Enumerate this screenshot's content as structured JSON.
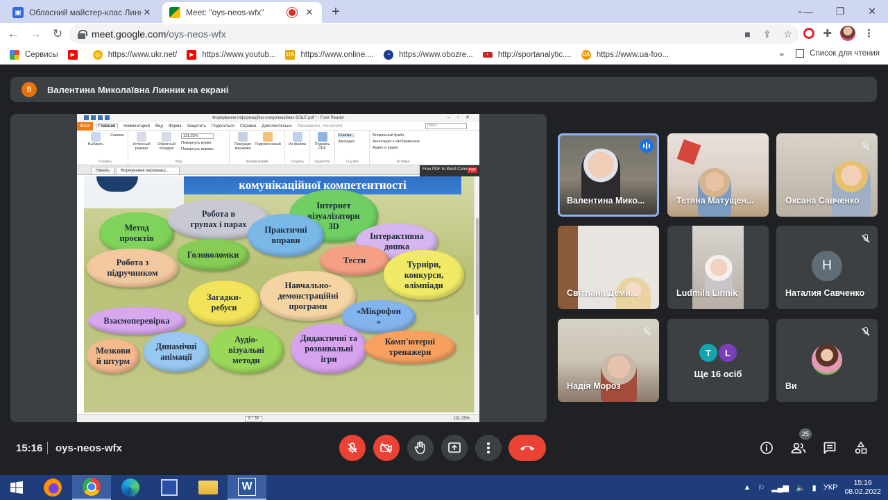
{
  "browser": {
    "tabs": [
      {
        "title": "Обласний майстер-клас Линник",
        "active": false
      },
      {
        "title": "Meet: \"oys-neos-wfx\"",
        "active": true
      }
    ],
    "new_tab": "+",
    "url_host": "meet.google.com",
    "url_path": "/oys-neos-wfx",
    "bookmarks": [
      {
        "label": "Сервисы",
        "icon": "apps-grid-icon",
        "color": "#ea4335"
      },
      {
        "label": "",
        "icon": "youtube-icon",
        "color": "#ff0000"
      },
      {
        "label": "https://www.ukr.net/",
        "icon": "ukrnet-icon",
        "color": "#f5b400"
      },
      {
        "label": "https://www.youtub...",
        "icon": "youtube-icon",
        "color": "#ff0000"
      },
      {
        "label": "https://www.online....",
        "icon": "online-icon",
        "color": "#e6a500"
      },
      {
        "label": "https://www.obozre...",
        "icon": "obozrevatel-icon",
        "color": "#1a73e8"
      },
      {
        "label": "http://sportanalytic....",
        "icon": "sport-icon",
        "color": "#c62828"
      },
      {
        "label": "https://www.ua-foo...",
        "icon": "uafootball-icon",
        "color": "#f29900"
      }
    ],
    "bookmarks_more": "»",
    "reading_list": "Список для чтения"
  },
  "meet": {
    "banner_avatar": "В",
    "banner_text": "Валентина Миколаївна Линник на екрані",
    "pdf": {
      "window_title": "Формування інформаційно-комунікаційних  ВЗШ7.pdf * - Foxit Reader",
      "menu": [
        "Файл",
        "Главная",
        "Комментарий",
        "Вид",
        "Форма",
        "Защитить",
        "Поделиться",
        "Справка",
        "Дополнительно",
        "Расскажите, что хотите"
      ],
      "search_placeholder": "Поиск",
      "ribbon_groups": [
        {
          "caption": "Утилиты",
          "items": [
            "Снимок",
            "Выбрать"
          ]
        },
        {
          "caption": "Вид",
          "items": [
            "Истинный размер",
            "Обратный порядок",
            "131,25%",
            "Повернуть влево",
            "Повернуть вправо"
          ]
        },
        {
          "caption": "Комментарий",
          "items": [
            "Пишущая машинка",
            "Подсвеченный"
          ]
        },
        {
          "caption": "Создать",
          "items": [
            "Из файла"
          ]
        },
        {
          "caption": "Защитить",
          "items": [
            "Подпись PDF"
          ]
        },
        {
          "caption": "Ссылки",
          "items": [
            "Ссылка",
            "Закладка"
          ]
        },
        {
          "caption": "Вставка",
          "items": [
            "Вложенный файл",
            "Аннотация к изображению",
            "Аудио и видео"
          ]
        }
      ],
      "doc_tabs": [
        "Начать",
        "Формування інформаці..."
      ],
      "converter_popup": "Free PDF to Word Converter",
      "converter_badge": "PDF",
      "slide_heading": "комунікаційної компетентності",
      "clouds": [
        {
          "text": "Метод\nпроєктів",
          "color": "#7fd35a"
        },
        {
          "text": "Робота в\nгрупах і парах",
          "color": "#c9c9d3"
        },
        {
          "text": "Інтернет\nвізуалізатори\n3D",
          "color": "#6fcf63"
        },
        {
          "text": "Практичні\nвправи",
          "color": "#7ab8e8"
        },
        {
          "text": "Інтерактивна\nдошка",
          "color": "#d6b6ef"
        },
        {
          "text": "Робота з\nпідручником",
          "color": "#f3c89e"
        },
        {
          "text": "Головоломки",
          "color": "#86cc55"
        },
        {
          "text": "Тести",
          "color": "#f5a083"
        },
        {
          "text": "Турніри,\nконкурси,\nолімпіади",
          "color": "#f0ea66"
        },
        {
          "text": "Загадки-\nребуси",
          "color": "#f1e35a"
        },
        {
          "text": "Навчально-\nдемонстраційні\nпрограми",
          "color": "#f5d4a4"
        },
        {
          "text": "Взаємоперевірка",
          "color": "#d8a8ef"
        },
        {
          "text": "«Мікрофон\n»",
          "color": "#84b4ee"
        },
        {
          "text": "Мозкови\nй штурм",
          "color": "#f5b98e"
        },
        {
          "text": "Динамічні\nанімації",
          "color": "#98c8ef"
        },
        {
          "text": "Аудіо-\nвізуальні\nметоди",
          "color": "#9ad85a"
        },
        {
          "text": "Дидактичні та\nрозвивальні\nігри",
          "color": "#d7a2ee"
        },
        {
          "text": "Комп'ютерні\nтренажери",
          "color": "#f8a060"
        }
      ],
      "page_indicator": "6 / 36",
      "zoom": "131,25%"
    },
    "participants": [
      {
        "name": "Валентина Мико...",
        "speaking": true,
        "muted": false
      },
      {
        "name": "Тетяна Матущен...",
        "speaking": false,
        "muted": false
      },
      {
        "name": "Оксана Савченко",
        "speaking": false,
        "muted": true
      },
      {
        "name": "Світлана Деми...",
        "speaking": false,
        "muted": false
      },
      {
        "name": "Ludmila Linnik",
        "speaking": false,
        "muted": false
      },
      {
        "name": "Наталия Савченко",
        "speaking": false,
        "muted": true,
        "initial": "Н"
      },
      {
        "name": "Надія Мороз",
        "speaking": false,
        "muted": true
      },
      {
        "name": "Ще 16 осіб",
        "speaking": false,
        "muted": false,
        "initials": [
          "T",
          "L"
        ]
      },
      {
        "name": "Ви",
        "speaking": false,
        "muted": true
      }
    ],
    "time": "15:16",
    "meeting_code": "oys-neos-wfx",
    "people_count": "25"
  },
  "taskbar": {
    "lang": "УКР",
    "time": "15:16",
    "date": "08.02.2022"
  },
  "colors": {
    "meet_bg": "#202124",
    "tile_bg": "#3c4043",
    "danger": "#ea4335",
    "accent": "#8ab4f8"
  }
}
